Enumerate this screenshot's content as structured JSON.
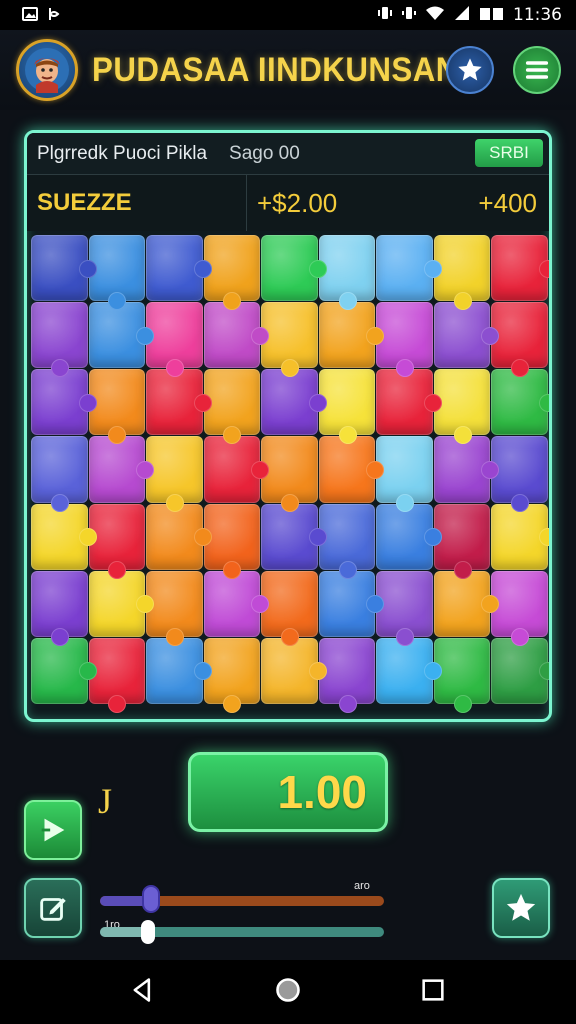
{
  "status_bar": {
    "time": "11:36"
  },
  "header": {
    "title": "PUDASAA IINDKUNSAN"
  },
  "panel": {
    "label": "Plgrredk Puoci Pikla",
    "meta": "Sago 00",
    "badge": "SRBI",
    "row_label": "SUEZZE",
    "value_1": "+$2.00",
    "value_2": "+400"
  },
  "controls": {
    "side_letter": "J",
    "value": "1.00",
    "slider1": {
      "label": "aro",
      "level": 0.18
    },
    "slider2": {
      "label": "1ro",
      "level": 0.17
    }
  },
  "puzzle": {
    "cols": 9,
    "rows": 7,
    "colors": [
      "#3a4fc2",
      "#3b8fe0",
      "#3f5bd0",
      "#f0a21c",
      "#2ecb56",
      "#7fd1f0",
      "#5bb0f2",
      "#f2d22a",
      "#e8233a",
      "#8a45d0",
      "#3b8fe0",
      "#ee3f9c",
      "#c04bc7",
      "#f6c02a",
      "#f2a31e",
      "#c64bd6",
      "#8c4fd0",
      "#e8233a",
      "#7b3fd0",
      "#f28a1c",
      "#e8233a",
      "#f2a31e",
      "#7b3fd0",
      "#f6e23a",
      "#e8233a",
      "#f4e03a",
      "#2fba44",
      "#5a62d9",
      "#b64ad0",
      "#f6c62a",
      "#e8233a",
      "#f28a1c",
      "#f6761c",
      "#7bd1f0",
      "#9a45d0",
      "#5a4bd0",
      "#f4d62a",
      "#e8233a",
      "#f28a1c",
      "#f2631c",
      "#5a4bd0",
      "#4a6ad9",
      "#3a7fe0",
      "#c21d4a",
      "#f4d62a",
      "#7b3fd0",
      "#f4d62a",
      "#f28a1c",
      "#c04bd6",
      "#f26a1c",
      "#3a7fe0",
      "#8a4fd0",
      "#f2a31e",
      "#c64bd6",
      "#27b84a",
      "#e8233a",
      "#3b8fe0",
      "#f2a31e",
      "#f4b52a",
      "#8a45d0",
      "#3bb0f0",
      "#2fba44",
      "#2e9e44"
    ]
  }
}
